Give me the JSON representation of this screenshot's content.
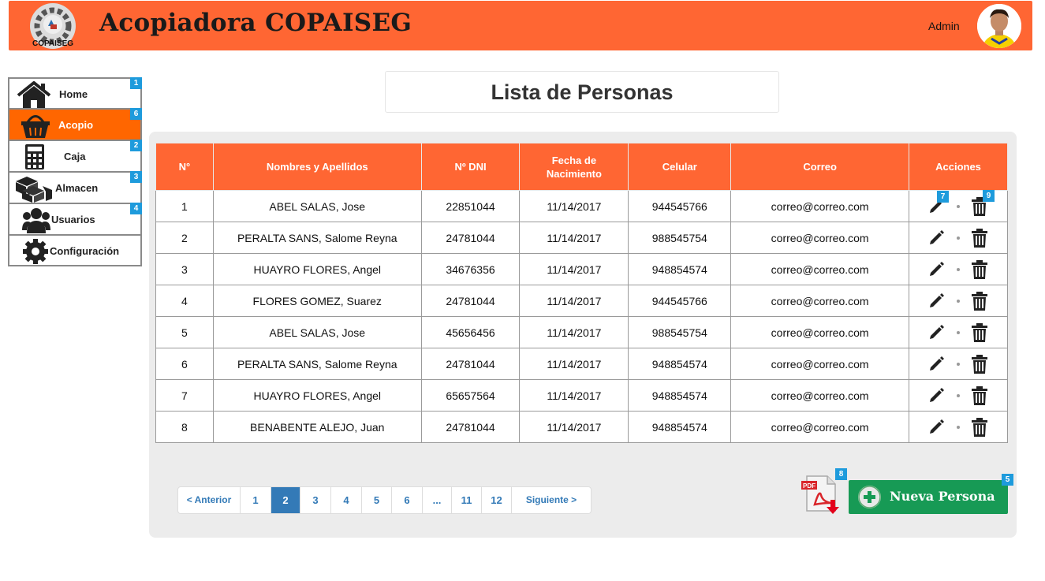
{
  "header": {
    "title": "Acopiadora COPAISEG",
    "logo_text": "COPAISEG",
    "user": "Admin",
    "bg_color": "#ff6633"
  },
  "sidebar": {
    "items": [
      {
        "label": "Home",
        "icon": "home-icon",
        "badge": "1",
        "active": false
      },
      {
        "label": "Acopio",
        "icon": "basket-icon",
        "badge": "6",
        "active": true
      },
      {
        "label": "Caja",
        "icon": "calculator-icon",
        "badge": "2",
        "active": false
      },
      {
        "label": "Almacen",
        "icon": "boxes-icon",
        "badge": "3",
        "active": false
      },
      {
        "label": "Usuarios",
        "icon": "users-icon",
        "badge": "4",
        "active": false
      },
      {
        "label": "Configuración",
        "icon": "gear-icon",
        "badge": "",
        "active": false
      }
    ]
  },
  "main": {
    "page_title": "Lista de Personas",
    "table": {
      "headers": {
        "num": "N°",
        "name": "Nombres y Apellidos",
        "dni": "Nº DNI",
        "birth_line1": "Fecha de",
        "birth_line2": "Nacimiento",
        "phone": "Celular",
        "email": "Correo",
        "actions": "Acciones"
      },
      "rows": [
        {
          "n": "1",
          "name": "ABEL SALAS, Jose",
          "dni": "22851044",
          "birth": "11/14/2017",
          "phone": "944545766",
          "email": "correo@correo.com"
        },
        {
          "n": "2",
          "name": "PERALTA SANS, Salome Reyna",
          "dni": "24781044",
          "birth": "11/14/2017",
          "phone": "988545754",
          "email": "correo@correo.com"
        },
        {
          "n": "3",
          "name": "HUAYRO FLORES, Angel",
          "dni": "34676356",
          "birth": "11/14/2017",
          "phone": "948854574",
          "email": "correo@correo.com"
        },
        {
          "n": "4",
          "name": "FLORES GOMEZ, Suarez",
          "dni": "24781044",
          "birth": "11/14/2017",
          "phone": "944545766",
          "email": "correo@correo.com"
        },
        {
          "n": "5",
          "name": "ABEL SALAS, Jose",
          "dni": "45656456",
          "birth": "11/14/2017",
          "phone": "988545754",
          "email": "correo@correo.com"
        },
        {
          "n": "6",
          "name": "PERALTA SANS, Salome Reyna",
          "dni": "24781044",
          "birth": "11/14/2017",
          "phone": "948854574",
          "email": "correo@correo.com"
        },
        {
          "n": "7",
          "name": "HUAYRO FLORES, Angel",
          "dni": "65657564",
          "birth": "11/14/2017",
          "phone": "948854574",
          "email": "correo@correo.com"
        },
        {
          "n": "8",
          "name": "BENABENTE ALEJO, Juan",
          "dni": "24781044",
          "birth": "11/14/2017",
          "phone": "948854574",
          "email": "correo@correo.com"
        }
      ],
      "edit_badge": "7",
      "delete_badge": "9"
    },
    "pagination": {
      "prev": "< Anterior",
      "pages": [
        "1",
        "2",
        "3",
        "4",
        "5",
        "6",
        "...",
        "11",
        "12"
      ],
      "current": "2",
      "next": "Siguiente >"
    },
    "pdf": {
      "label": "PDF",
      "badge": "8"
    },
    "new_button": {
      "label": "Nueva Persona",
      "badge": "5",
      "color": "#179a55"
    }
  }
}
